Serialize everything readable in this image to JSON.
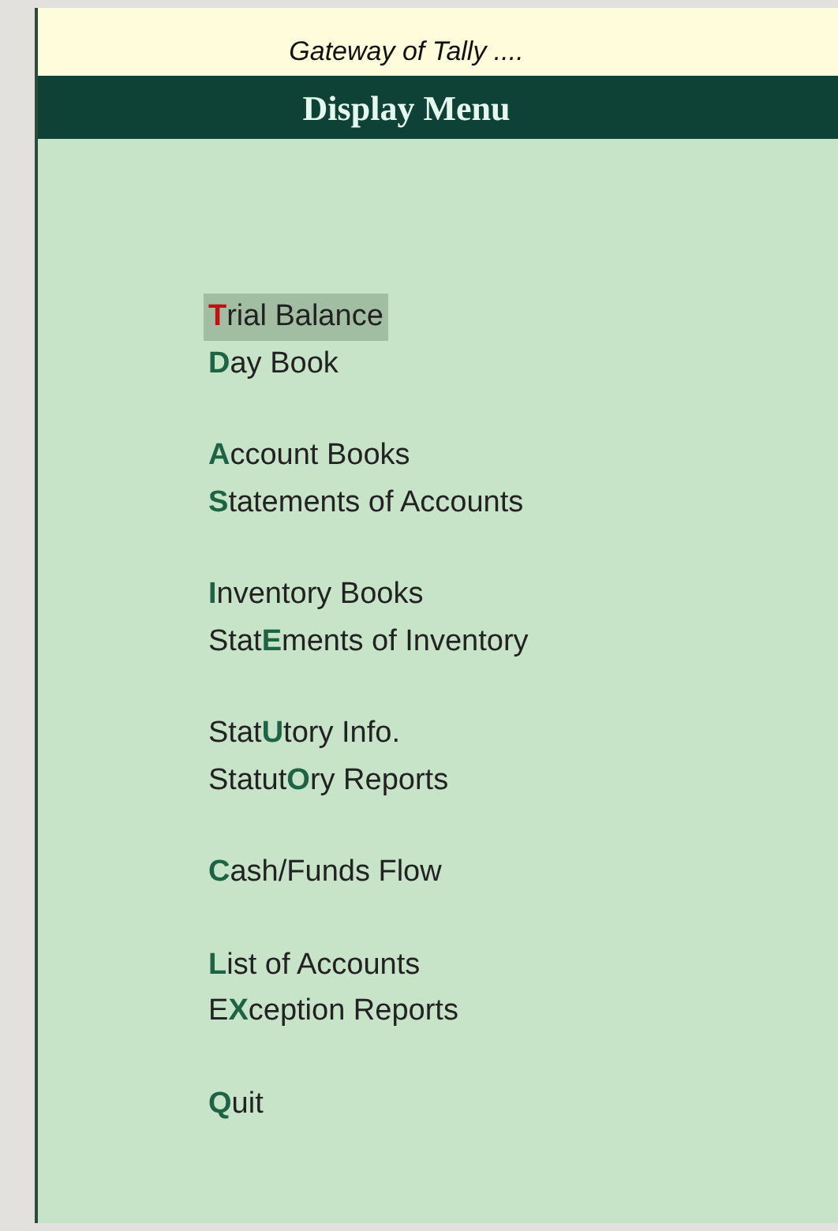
{
  "window": {
    "title": "Gateway of Tally ...."
  },
  "menu": {
    "title": "Display Menu",
    "groups": [
      {
        "items": [
          {
            "label": "**T**rial Balance",
            "selected": true
          },
          {
            "label": "**D**ay Book",
            "selected": false
          }
        ]
      },
      {
        "items": [
          {
            "label": "**A**ccount Books",
            "selected": false
          },
          {
            "label": "**S**tatements of Accounts",
            "selected": false
          }
        ]
      },
      {
        "items": [
          {
            "label": "**I**nventory Books",
            "selected": false
          },
          {
            "label": "Stat**E**ments of Inventory",
            "selected": false
          }
        ]
      },
      {
        "items": [
          {
            "label": "Stat**U**tory Info.",
            "selected": false
          },
          {
            "label": "Statut**O**ry Reports",
            "selected": false
          }
        ]
      },
      {
        "items": [
          {
            "label": "**C**ash/Funds Flow",
            "selected": false
          }
        ]
      },
      {
        "items": [
          {
            "label": "**L**ist of Accounts",
            "selected": false
          },
          {
            "label": "E**X**ception Reports",
            "selected": false
          }
        ]
      },
      {
        "items": [
          {
            "label": "**Q**uit",
            "selected": false
          }
        ]
      }
    ]
  }
}
